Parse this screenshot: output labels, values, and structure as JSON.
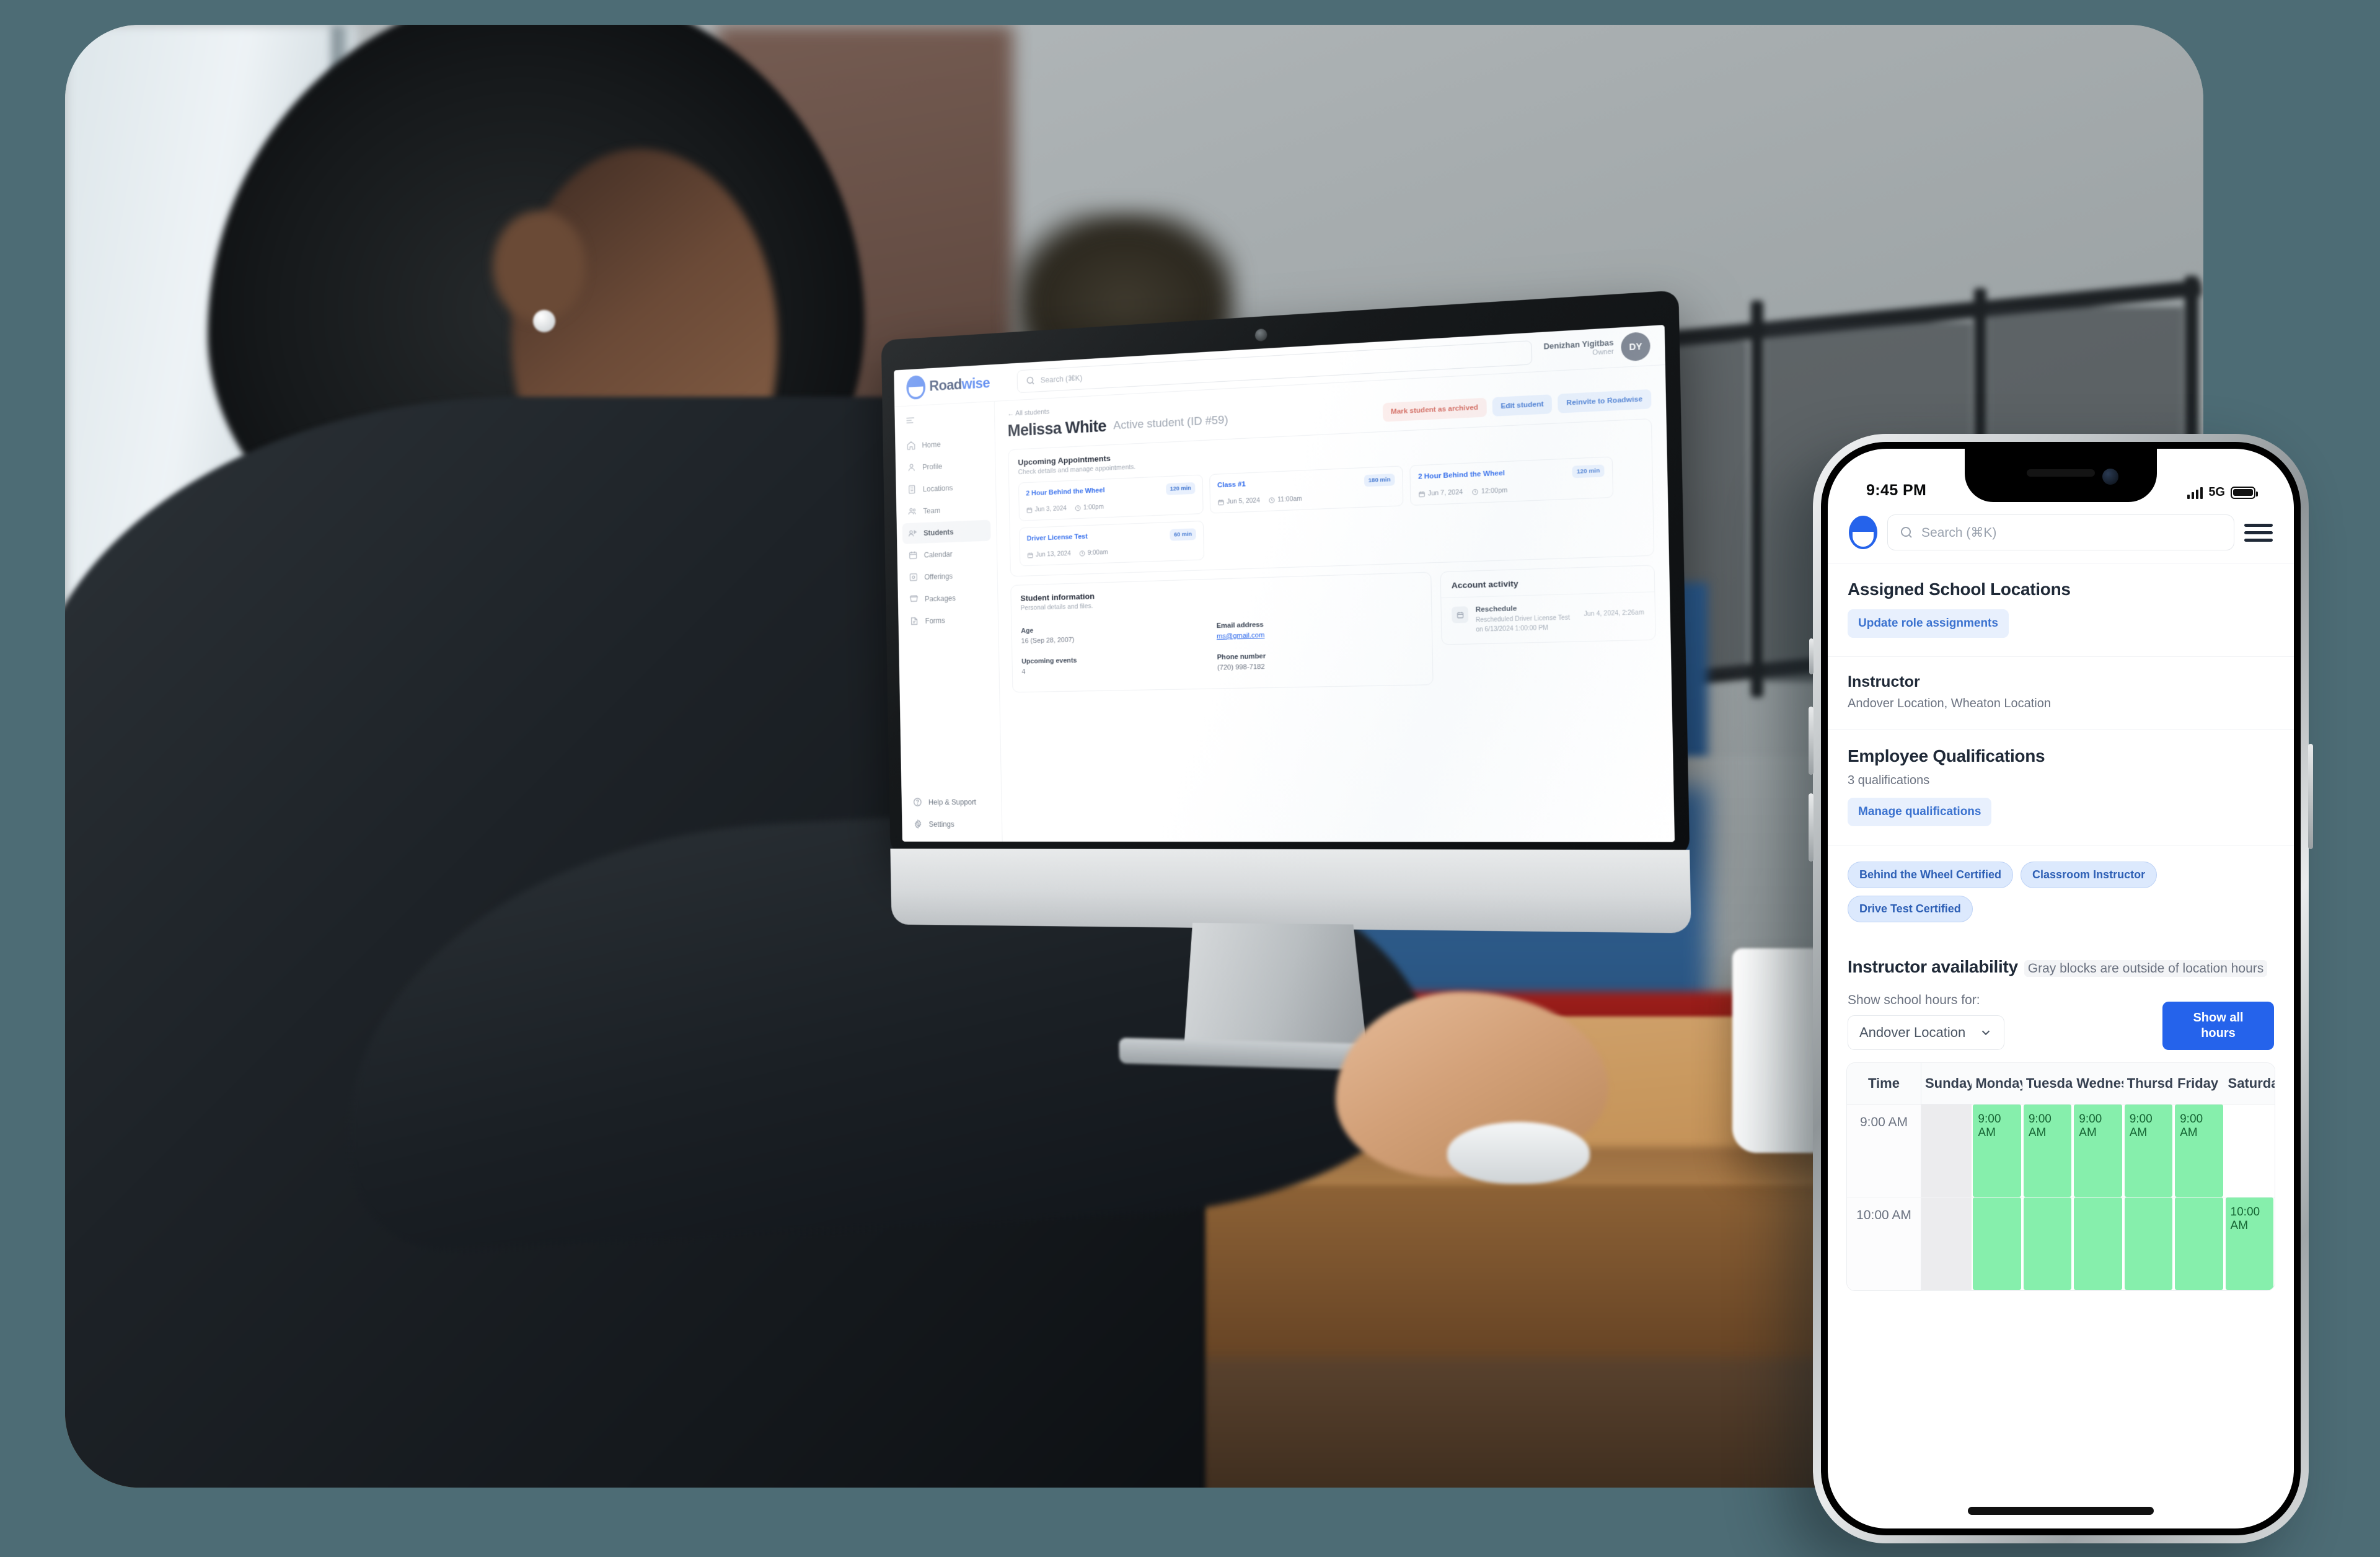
{
  "desktop": {
    "brand": {
      "name_a": "Road",
      "name_b": "wise"
    },
    "search_placeholder": "Search (⌘K)",
    "user": {
      "name": "Denizhan Yigitbas",
      "role": "Owner",
      "initials": "DY"
    },
    "sidebar": {
      "items": [
        {
          "label": "Home",
          "icon": "home-icon"
        },
        {
          "label": "Profile",
          "icon": "user-icon"
        },
        {
          "label": "Locations",
          "icon": "building-icon"
        },
        {
          "label": "Team",
          "icon": "team-icon"
        },
        {
          "label": "Students",
          "icon": "students-icon"
        },
        {
          "label": "Calendar",
          "icon": "calendar-icon"
        },
        {
          "label": "Offerings",
          "icon": "offerings-icon"
        },
        {
          "label": "Packages",
          "icon": "packages-icon"
        },
        {
          "label": "Forms",
          "icon": "forms-icon"
        }
      ],
      "bottom": [
        {
          "label": "Help & Support",
          "icon": "help-icon"
        },
        {
          "label": "Settings",
          "icon": "gear-icon"
        }
      ]
    },
    "breadcrumb": "← All students",
    "page_title": "Melissa White",
    "page_subtitle": "Active student (ID #59)",
    "actions": {
      "archive": "Mark student as archived",
      "edit": "Edit student",
      "reinvite": "Reinvite to Roadwise"
    },
    "appointments_card": {
      "title": "Upcoming Appointments",
      "desc": "Check details and manage appointments.",
      "items": [
        {
          "name": "2 Hour Behind the Wheel",
          "duration": "120 min",
          "date": "Jun 3, 2024",
          "time": "1:00pm"
        },
        {
          "name": "Class #1",
          "duration": "180 min",
          "date": "Jun 5, 2024",
          "time": "11:00am"
        },
        {
          "name": "2 Hour Behind the Wheel",
          "duration": "120 min",
          "date": "Jun 7, 2024",
          "time": "12:00pm"
        },
        {
          "name": "Driver License Test",
          "duration": "60 min",
          "date": "Jun 13, 2024",
          "time": "9:00am"
        }
      ]
    },
    "student_info": {
      "title": "Student information",
      "desc": "Personal details and files.",
      "fields": [
        {
          "key": "Age",
          "value": "16 (Sep 28, 2007)"
        },
        {
          "key": "Email address",
          "value": "ms@gmail.com",
          "is_link": true
        },
        {
          "key": "Upcoming events",
          "value": "4"
        },
        {
          "key": "Phone number",
          "value": "(720) 998-7182"
        }
      ]
    },
    "account_activity": {
      "title": "Account activity",
      "items": [
        {
          "title": "Reschedule",
          "desc": "Rescheduled Driver License Test on 6/13/2024 1:00:00 PM",
          "time": "Jun 4, 2024, 2:26am"
        }
      ]
    }
  },
  "phone": {
    "status": {
      "time": "9:45 PM",
      "network": "5G"
    },
    "search_placeholder": "Search (⌘K)",
    "sections": {
      "assigned": {
        "title": "Assigned School Locations",
        "button": "Update role assignments",
        "role": "Instructor",
        "locations": "Andover Location, Wheaton Location"
      },
      "qualifications": {
        "title": "Employee Qualifications",
        "count": "3 qualifications",
        "button": "Manage qualifications",
        "tags": [
          "Behind the Wheel Certified",
          "Classroom Instructor",
          "Drive Test Certified"
        ]
      },
      "availability": {
        "title": "Instructor availability",
        "note": "Gray blocks are outside of location hours",
        "filter_label": "Show school hours for:",
        "location": "Andover Location",
        "show_all": "Show all hours",
        "table": {
          "headers": [
            "Time",
            "Sunday",
            "Monday",
            "Tuesday",
            "Wednesday",
            "Thursday",
            "Friday",
            "Saturday"
          ],
          "rows": [
            {
              "time": "9:00 AM",
              "cells": [
                {
                  "state": "gray",
                  "label": ""
                },
                {
                  "state": "open",
                  "label": "9:00 AM"
                },
                {
                  "state": "open",
                  "label": "9:00 AM"
                },
                {
                  "state": "open",
                  "label": "9:00 AM"
                },
                {
                  "state": "open",
                  "label": "9:00 AM"
                },
                {
                  "state": "open",
                  "label": "9:00 AM"
                },
                {
                  "state": "empty",
                  "label": ""
                }
              ]
            },
            {
              "time": "10:00 AM",
              "cells": [
                {
                  "state": "gray",
                  "label": ""
                },
                {
                  "state": "open",
                  "label": ""
                },
                {
                  "state": "open",
                  "label": ""
                },
                {
                  "state": "open",
                  "label": ""
                },
                {
                  "state": "open",
                  "label": ""
                },
                {
                  "state": "open",
                  "label": ""
                },
                {
                  "state": "open",
                  "label": "10:00 AM"
                }
              ]
            }
          ]
        }
      }
    }
  }
}
